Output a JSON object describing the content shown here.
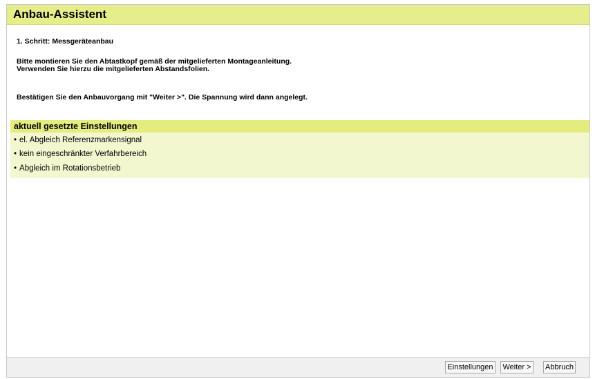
{
  "window": {
    "title": "Anbau-Assistent"
  },
  "content": {
    "step_label": "1. Schritt: Messgeräteanbau",
    "instruction_line1": "Bitte montieren Sie den Abtastkopf gemäß der mitgelieferten Montageanleitung.",
    "instruction_line2": "Verwenden Sie hierzu die mitgelieferten Abstandsfolien.",
    "confirm_text": "Bestätigen Sie den Anbauvorgang mit \"Weiter >\". Die Spannung wird dann angelegt."
  },
  "settings": {
    "header": "aktuell gesetzte Einstellungen",
    "bullet": "•",
    "items": [
      "el. Abgleich Referenzmarkensignal",
      "kein eingeschränkter Verfahrbereich",
      "Abgleich im Rotationsbetrieb"
    ]
  },
  "footer": {
    "settings_label": "Einstellungen",
    "next_label": "Weiter >",
    "cancel_label": "Abbruch"
  },
  "colors": {
    "title_bar": "#e6ee8c",
    "settings_header": "#e4ec80",
    "settings_body": "#f2f7d0",
    "footer": "#f0f0f0"
  }
}
